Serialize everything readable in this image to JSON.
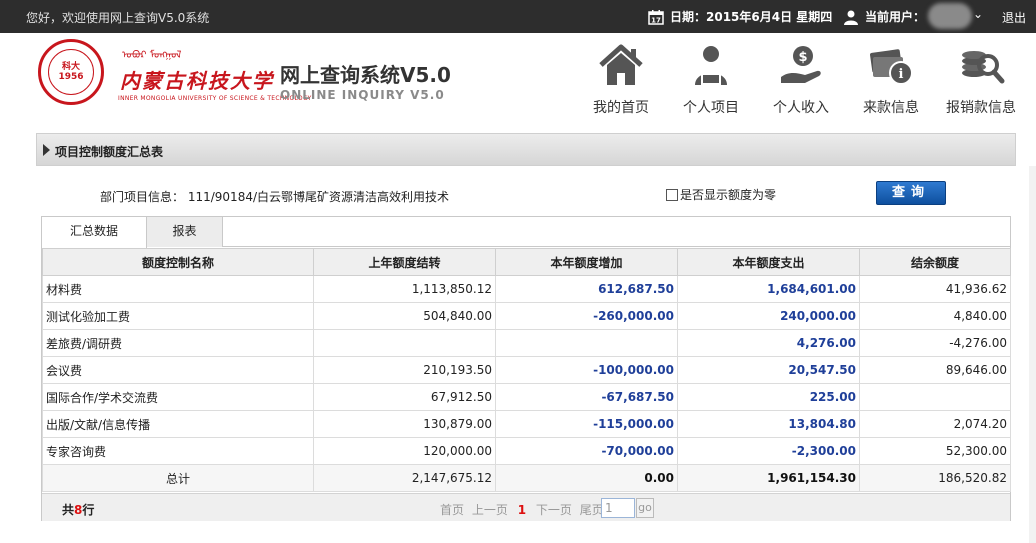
{
  "topbar": {
    "welcome": "您好，欢迎使用网上查询V5.0系统",
    "date": "日期：2015年6月4日 星期四",
    "current_user_label": "当前用户：",
    "logout": "退出"
  },
  "header": {
    "university_cn": "内蒙古科技大学",
    "university_mn": "ᠣᠪᠦᠷ ᠮᠣᠩᠭᠣᠯ",
    "university_en": "INNER MONGOLIA UNIVERSITY OF SCIENCE & TECHNOLOGY",
    "seal_text": "科大 1956",
    "system_title": "网上查询系统V5.0",
    "system_subtitle": "ONLINE INQUIRY V5.0"
  },
  "nav": [
    {
      "label": "我的首页",
      "icon": "home-icon"
    },
    {
      "label": "个人项目",
      "icon": "person-icon"
    },
    {
      "label": "个人收入",
      "icon": "income-icon"
    },
    {
      "label": "来款信息",
      "icon": "payment-info-icon"
    },
    {
      "label": "报销款信息",
      "icon": "reimbursement-search-icon"
    }
  ],
  "section": {
    "title": "项目控制额度汇总表"
  },
  "filter": {
    "dept_label": "部门项目信息：",
    "dept_value": "111/90184/白云鄂博尾矿资源清洁高效利用技术",
    "checkbox_label": "是否显示额度为零",
    "query_button": "查询"
  },
  "tabs": [
    {
      "label": "汇总数据",
      "active": true
    },
    {
      "label": "报表",
      "active": false
    }
  ],
  "table": {
    "columns": [
      "额度控制名称",
      "上年额度结转",
      "本年额度增加",
      "本年额度支出",
      "结余额度"
    ],
    "rows": [
      [
        "材料费",
        "1,113,850.12",
        "612,687.50",
        "1,684,601.00",
        "41,936.62"
      ],
      [
        "测试化验加工费",
        "504,840.00",
        "-260,000.00",
        "240,000.00",
        "4,840.00"
      ],
      [
        "差旅费/调研费",
        "",
        "",
        "4,276.00",
        "-4,276.00"
      ],
      [
        "会议费",
        "210,193.50",
        "-100,000.00",
        "20,547.50",
        "89,646.00"
      ],
      [
        "国际合作/学术交流费",
        "67,912.50",
        "-67,687.50",
        "225.00",
        ""
      ],
      [
        "出版/文献/信息传播",
        "130,879.00",
        "-115,000.00",
        "13,804.80",
        "2,074.20"
      ],
      [
        "专家咨询费",
        "120,000.00",
        "-70,000.00",
        "-2,300.00",
        "52,300.00"
      ]
    ],
    "total": [
      "总计",
      "2,147,675.12",
      "0.00",
      "1,961,154.30",
      "186,520.82"
    ]
  },
  "pager": {
    "count_prefix": "共",
    "count": "8",
    "count_suffix": "行",
    "first": "首页",
    "prev": "上一页",
    "current": "1",
    "next": "下一页",
    "last": "尾页",
    "page_input": "1",
    "go": "go"
  },
  "colors": {
    "topbar": "#2d2d2d",
    "brand_red": "#c8161d",
    "value_blue": "#1f3f99",
    "button_blue": "#0e4f9e"
  }
}
